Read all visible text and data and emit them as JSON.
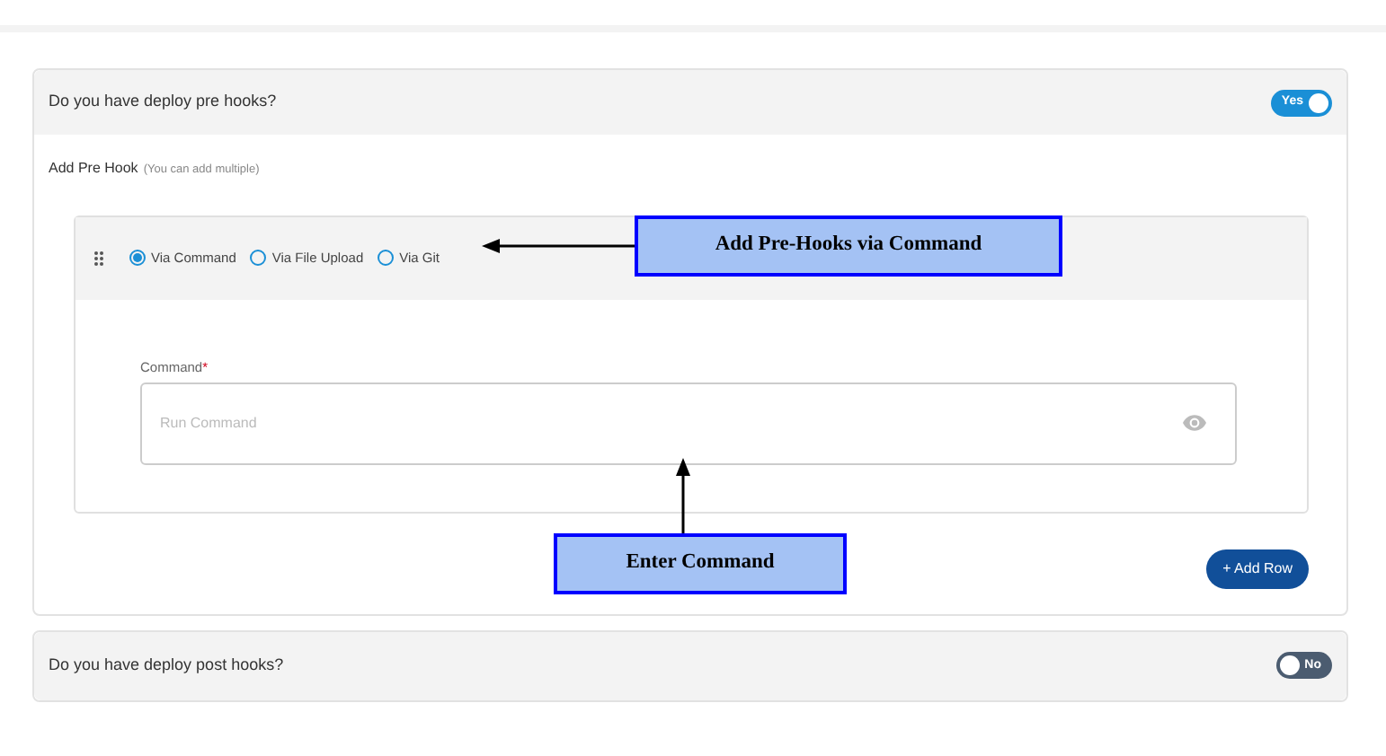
{
  "pre_hooks": {
    "question": "Do you have deploy pre hooks?",
    "toggle": {
      "label": "Yes",
      "on": true
    },
    "title": "Add Pre Hook",
    "hint": "(You can add multiple)",
    "options": [
      {
        "label": "Via Command",
        "selected": true
      },
      {
        "label": "Via File Upload",
        "selected": false
      },
      {
        "label": "Via Git",
        "selected": false
      }
    ],
    "field": {
      "label": "Command",
      "required_mark": "*",
      "placeholder": "Run Command"
    },
    "add_button": "+ Add Row"
  },
  "post_hooks": {
    "question": "Do you have deploy post hooks?",
    "toggle": {
      "label": "No",
      "on": false
    }
  },
  "annotations": [
    {
      "text": "Add Pre-Hooks via Command"
    },
    {
      "text": "Enter Command"
    }
  ]
}
